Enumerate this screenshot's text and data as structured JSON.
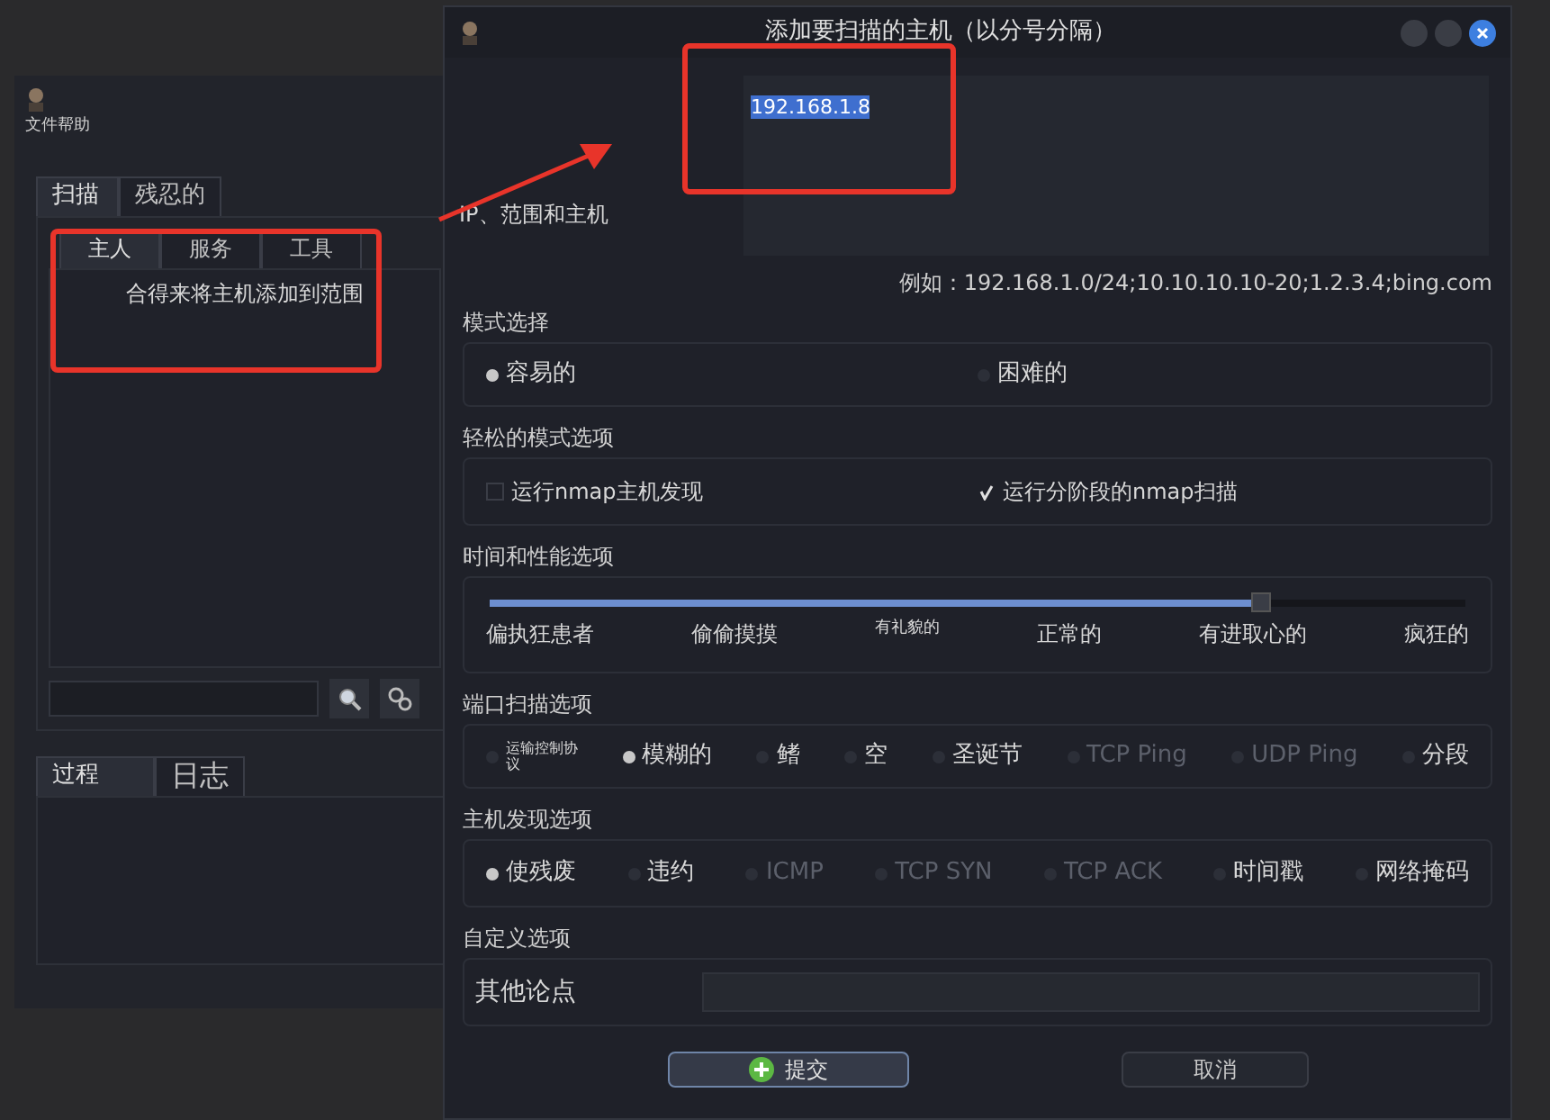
{
  "main_window": {
    "menu": "文件帮助",
    "tabs": [
      {
        "label": "扫描",
        "selected": true
      },
      {
        "label": "残忍的",
        "selected": false
      }
    ],
    "host_tabs": [
      {
        "label": "主人",
        "selected": true
      },
      {
        "label": "服务",
        "selected": false
      },
      {
        "label": "工具",
        "selected": false
      }
    ],
    "hint": "合得来将主机添加到范围",
    "log_tabs": [
      {
        "label": "过程",
        "selected": true
      },
      {
        "label": "日志",
        "selected": false
      }
    ]
  },
  "dialog": {
    "title": "添加要扫描的主机（以分号分隔）",
    "ip_label": "IP、范围和主机",
    "ip_value": "192.168.1.8",
    "example": "例如：192.168.1.0/24;10.10.10.10-20;1.2.3.4;bing.com",
    "mode": {
      "title": "模式选择",
      "options": [
        {
          "label": "容易的",
          "selected": true
        },
        {
          "label": "困难的",
          "selected": false
        }
      ]
    },
    "easy_options": {
      "title": "轻松的模式选项",
      "items": [
        {
          "label": "运行nmap主机发现",
          "checked": false
        },
        {
          "label": "运行分阶段的nmap扫描",
          "checked": true
        }
      ]
    },
    "timing": {
      "title": "时间和性能选项",
      "level": 0.79,
      "labels": [
        "偏执狂患者",
        "偷偷摸摸",
        "有礼貌的",
        "正常的",
        "有进取心的",
        "疯狂的"
      ]
    },
    "port_scan": {
      "title": "端口扫描选项",
      "options": [
        {
          "label": "运输控制协议",
          "selected": false,
          "disabled": false
        },
        {
          "label": "模糊的",
          "selected": true,
          "disabled": false
        },
        {
          "label": "鳍",
          "selected": false,
          "disabled": false
        },
        {
          "label": "空",
          "selected": false,
          "disabled": false
        },
        {
          "label": "圣诞节",
          "selected": false,
          "disabled": false
        },
        {
          "label": "TCP Ping",
          "selected": false,
          "disabled": true
        },
        {
          "label": "UDP Ping",
          "selected": false,
          "disabled": true
        },
        {
          "label": "分段",
          "selected": false,
          "disabled": false
        }
      ]
    },
    "host_discovery": {
      "title": "主机发现选项",
      "options": [
        {
          "label": "使残废",
          "selected": true,
          "disabled": false
        },
        {
          "label": "违约",
          "selected": false,
          "disabled": false
        },
        {
          "label": "ICMP",
          "selected": false,
          "disabled": true
        },
        {
          "label": "TCP SYN",
          "selected": false,
          "disabled": true
        },
        {
          "label": "TCP ACK",
          "selected": false,
          "disabled": true
        },
        {
          "label": "时间戳",
          "selected": false,
          "disabled": false
        },
        {
          "label": "网络掩码",
          "selected": false,
          "disabled": false
        }
      ]
    },
    "custom": {
      "title": "自定义选项",
      "label": "其他论点"
    },
    "buttons": [
      {
        "label": "提交",
        "kind": "submit"
      },
      {
        "label": "取消",
        "kind": "cancel"
      }
    ]
  }
}
